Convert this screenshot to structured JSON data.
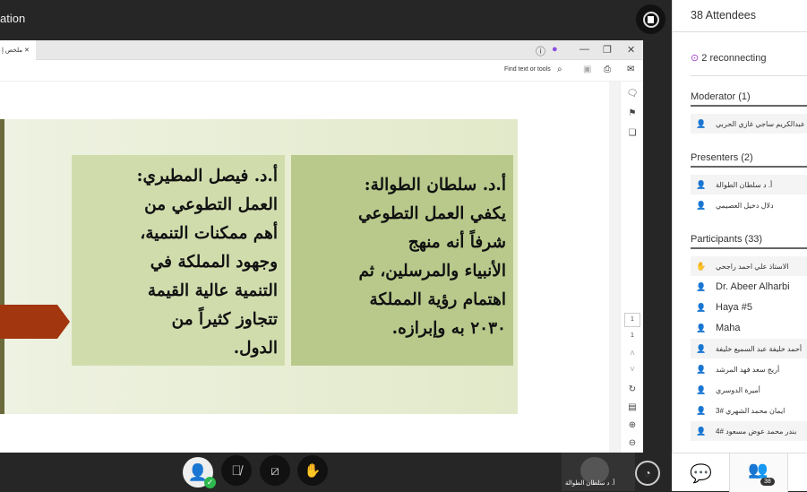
{
  "topbar": {
    "title": "ation",
    "record_icon": "stop-record-icon"
  },
  "viewer": {
    "tab_label": "ملخص إ",
    "find_placeholder": "Find text or tools",
    "page_current": "1",
    "page_total": "1"
  },
  "slide": {
    "box1": [
      "أ.د. فيصل المطيري:",
      "العمل التطوعي من",
      "أهم ممكنات التنمية،",
      "وجهود المملكة في",
      "التنمية عالية القيمة",
      "تتجاوز كثيراً من",
      "الدول."
    ],
    "box2": [
      "أ.د. سلطان الطوالة:",
      "يكفي العمل التطوعي",
      "شرفاً أنه منهج",
      "الأنبياء والمرسلين، ثم",
      "اهتمام رؤية المملكة",
      "٢٠٣٠ به وإبرازه."
    ],
    "colors": {
      "arrow": "#a2360f",
      "box1": "#d1dcad",
      "box2": "#b8c98b"
    }
  },
  "video": {
    "presenter_name": "أ. د سلطان الطوالة"
  },
  "panel": {
    "title": "38 Attendees",
    "reconnecting": "2 reconnecting",
    "moderator_header": "Moderator (1)",
    "moderators": [
      "عبدالكريم ساجي غازي الحربي"
    ],
    "presenters_header": "Presenters (2)",
    "presenters": [
      "أ. د سلطان الطوالة",
      "دلال دخيل العصيمي"
    ],
    "participants_header": "Participants (33)",
    "participants": [
      "الاستاذ علي احمد راجحي",
      "Dr. Abeer Alharbi",
      "Haya #5",
      "Maha",
      "أحمد خليفة عبد السميع خليفة",
      "أريج سعد فهد المرشد",
      "أميرة الدوسري",
      "ايمان محمد الشهري #3",
      "بندر محمد عوض مسعود #4"
    ],
    "badge_count": "38"
  }
}
